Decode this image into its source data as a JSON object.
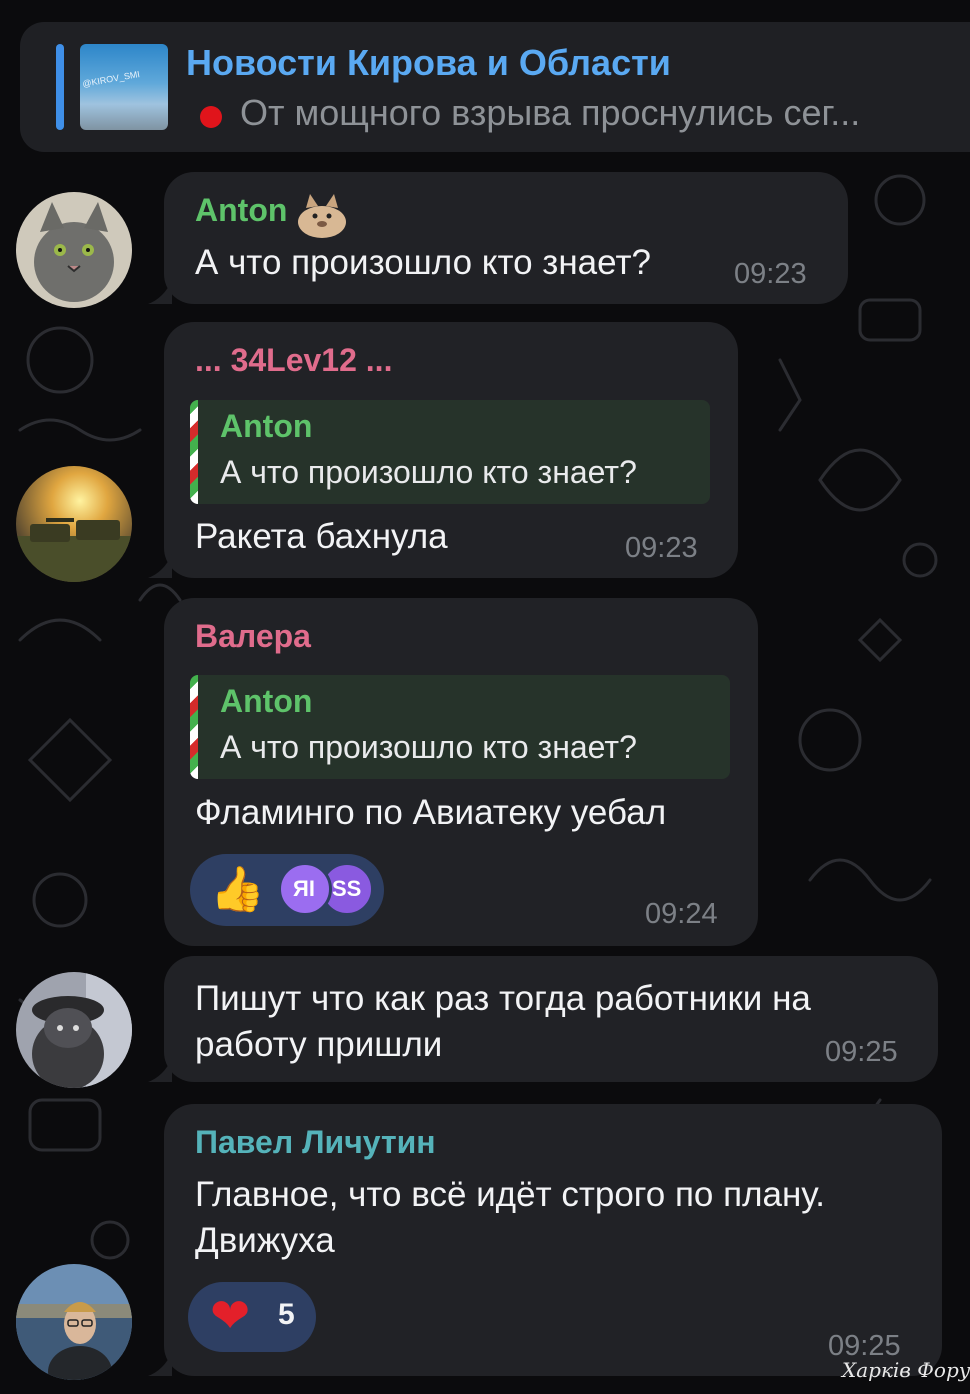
{
  "pinned": {
    "thumb_watermark": "@KIROV_SMI",
    "title": "Новости Кирова и Области",
    "text": "От мощного взрыва проснулись сег..."
  },
  "messages": [
    {
      "sender": "Anton",
      "text": "А что произошло кто знает?",
      "time": "09:23"
    },
    {
      "sender": "... 34Lev12 ...",
      "reply_to": {
        "name": "Anton",
        "text": "А что произошло кто знает?"
      },
      "text": "Ракета бахнула",
      "time": "09:23"
    },
    {
      "sender": "Валера",
      "reply_to": {
        "name": "Anton",
        "text": "А что произошло кто знает?"
      },
      "text": "Фламинго по Авиатеку уебал",
      "reaction": {
        "emoji": "👍",
        "users": [
          "ЯI",
          "SS"
        ]
      },
      "time": "09:24"
    },
    {
      "lines": [
        "Пишут что как раз тогда работники на",
        "работу пришли"
      ],
      "time": "09:25"
    },
    {
      "sender": "Павел Личутин",
      "lines": [
        "Главное, что всё идёт строго по плану.",
        "Движуха"
      ],
      "reaction": {
        "emoji": "❤",
        "count": "5"
      },
      "time": "09:25"
    }
  ],
  "colors": {
    "background": "#0b0b0d",
    "bubble": "#212226",
    "name_green": "#5ec36a",
    "name_pink": "#e06c8c",
    "name_teal": "#55b3ba",
    "pinned_accent": "#3f8fe8",
    "reaction_bg": "#2e3f63"
  },
  "watermark": "Харків Форум"
}
